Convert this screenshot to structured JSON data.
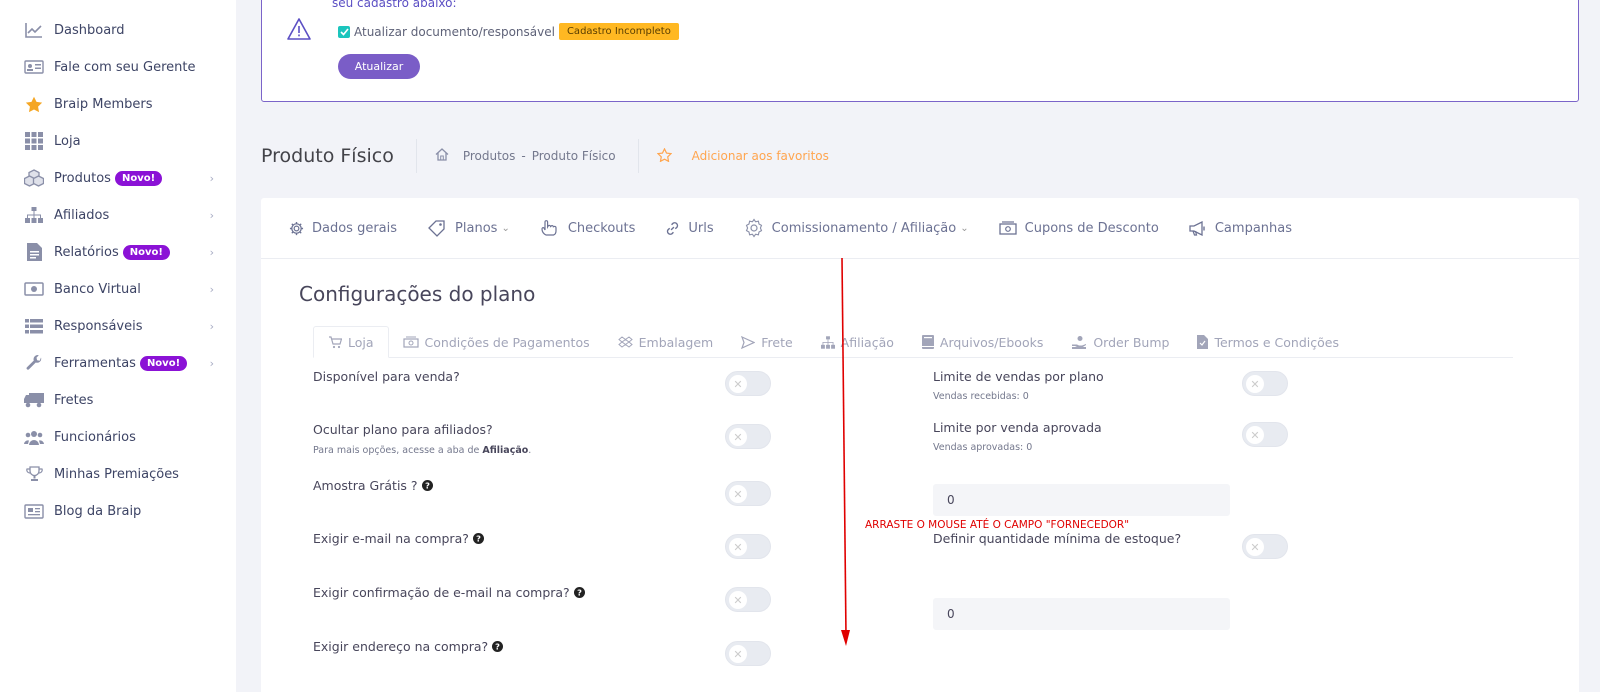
{
  "sidebar": {
    "items": [
      {
        "label": "Dashboard",
        "icon": "chart-line-icon"
      },
      {
        "label": "Fale com seu Gerente",
        "icon": "id-card-icon"
      },
      {
        "label": "Braip Members",
        "icon": "star-icon"
      },
      {
        "label": "Loja",
        "icon": "grid-icon"
      },
      {
        "label": "Produtos",
        "icon": "boxes-icon",
        "badge": "Novo!"
      },
      {
        "label": "Afiliados",
        "icon": "sitemap-icon"
      },
      {
        "label": "Relatórios",
        "icon": "document-icon",
        "badge": "Novo!"
      },
      {
        "label": "Banco Virtual",
        "icon": "money-icon"
      },
      {
        "label": "Responsáveis",
        "icon": "list-icon"
      },
      {
        "label": "Ferramentas",
        "icon": "wrench-icon",
        "badge": "Novo!"
      },
      {
        "label": "Fretes",
        "icon": "truck-icon"
      },
      {
        "label": "Funcionários",
        "icon": "users-icon"
      },
      {
        "label": "Minhas Premiações",
        "icon": "trophy-icon"
      },
      {
        "label": "Blog da Braip",
        "icon": "newspaper-icon"
      }
    ]
  },
  "alert": {
    "top_text": "seu cadastro abaixo:",
    "checkbox_label": "Atualizar documento/responsável",
    "badge": "Cadastro Incompleto",
    "button": "Atualizar"
  },
  "subheader": {
    "title": "Produto Físico",
    "crumb1": "Produtos",
    "crumb_sep": "-",
    "crumb2": "Produto Físico",
    "favorite": "Adicionar aos favoritos"
  },
  "topnav": {
    "items": [
      {
        "label": "Dados gerais",
        "icon": "gear-icon"
      },
      {
        "label": "Planos",
        "icon": "tag-icon",
        "dropdown": true
      },
      {
        "label": "Checkouts",
        "icon": "hand-pointer-icon"
      },
      {
        "label": "Urls",
        "icon": "link-icon"
      },
      {
        "label": "Comissionamento / Afiliação",
        "icon": "gear-icon",
        "dropdown": true
      },
      {
        "label": "Cupons de Desconto",
        "icon": "money-bill-icon"
      },
      {
        "label": "Campanhas",
        "icon": "megaphone-icon"
      }
    ]
  },
  "section_title": "Configurações do plano",
  "subtabs": [
    {
      "label": "Loja",
      "icon": "cart-icon",
      "active": true
    },
    {
      "label": "Condições de Pagamentos",
      "icon": "money-bill-icon"
    },
    {
      "label": "Embalagem",
      "icon": "dropbox-icon"
    },
    {
      "label": "Frete",
      "icon": "send-icon"
    },
    {
      "label": "Afiliação",
      "icon": "sitemap-icon"
    },
    {
      "label": "Arquivos/Ebooks",
      "icon": "book-icon"
    },
    {
      "label": "Order Bump",
      "icon": "hand-coin-icon"
    },
    {
      "label": "Termos e Condições",
      "icon": "file-icon"
    }
  ],
  "left_fields": {
    "f1": "Disponível para venda?",
    "f2": "Ocultar plano para afiliados?",
    "f2_help_pre": "Para mais opções, acesse a aba de",
    "f2_help_bold": "Afiliação",
    "f2_help_post": ".",
    "f3": "Amostra Grátis ?",
    "f4": "Exigir e-mail na compra?",
    "f5": "Exigir confirmação de e-mail na compra?",
    "f6": "Exigir endereço na compra?"
  },
  "right_fields": {
    "r1": "Limite de vendas por plano",
    "r1_help": "Vendas recebidas: 0",
    "r2": "Limite por venda aprovada",
    "r2_help": "Vendas aprovadas: 0",
    "input1": "0",
    "r3": "Definir quantidade mínima de estoque?",
    "input2": "0"
  },
  "toggles_on": [
    false,
    false,
    false,
    false,
    false,
    false,
    false,
    false,
    false
  ],
  "annotation": "ARRASTE O MOUSE ATÉ O CAMPO \"FORNECEDOR\"",
  "colors": {
    "accent": "#7a5dc7",
    "badge_new": "#8b12d6",
    "warning": "#ffb822",
    "favorite": "#ffa54f",
    "annotation": "#e00000"
  }
}
